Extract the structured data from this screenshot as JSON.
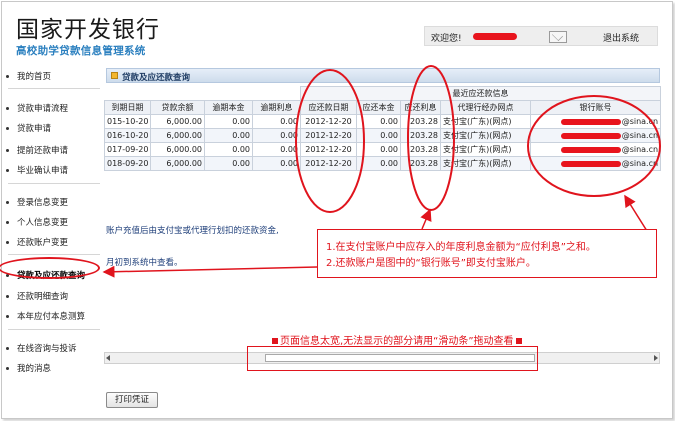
{
  "header": {
    "logo_main": "国家开发银行",
    "logo_sub": "高校助学贷款信息管理系统",
    "welcome": "欢迎您!",
    "logout": "退出系统"
  },
  "sidebar": {
    "items": [
      {
        "label": "我的首页"
      },
      {
        "label": "贷款申请流程"
      },
      {
        "label": "贷款申请"
      },
      {
        "label": "提前还款申请"
      },
      {
        "label": "毕业确认申请"
      },
      {
        "label": "登录信息变更"
      },
      {
        "label": "个人信息变更"
      },
      {
        "label": "还款账户变更"
      },
      {
        "label": "贷款及应还款查询",
        "active": true
      },
      {
        "label": "还款明细查询"
      },
      {
        "label": "本年应付本息测算"
      },
      {
        "label": "在线咨询与投诉"
      },
      {
        "label": "我的消息"
      }
    ]
  },
  "panel": {
    "title": "贷款及应还款查询",
    "group_header": "最近应还款信息",
    "columns": [
      "到期日期",
      "贷款余额",
      "逾期本金",
      "逾期利息",
      "应还款日期",
      "应还本金",
      "应还利息",
      "代理行经办网点",
      "银行账号"
    ],
    "rows": [
      [
        "015-10-20",
        "6,000.00",
        "0.00",
        "0.00",
        "2012-12-20",
        "0.00",
        "203.28",
        "支付宝(广东)(网点)",
        "@sina.cn"
      ],
      [
        "016-10-20",
        "6,000.00",
        "0.00",
        "0.00",
        "2012-12-20",
        "0.00",
        "203.28",
        "支付宝(广东)(网点)",
        "@sina.cn"
      ],
      [
        "017-09-20",
        "6,000.00",
        "0.00",
        "0.00",
        "2012-12-20",
        "0.00",
        "203.28",
        "支付宝(广东)(网点)",
        "@sina.cn"
      ],
      [
        "018-09-20",
        "6,000.00",
        "0.00",
        "0.00",
        "2012-12-20",
        "0.00",
        "203.28",
        "支付宝(广东)(网点)",
        "@sina.cn"
      ]
    ],
    "note1": "账户充值后由支付宝或代理行划扣的还款资金,",
    "note2": "月初到系统中查看。"
  },
  "annotations": {
    "callout_line1": "1.在支付宝账户中应存入的年度利息金额为“应付利息”之和。",
    "callout_line2": "2.还款账户是图中的“银行账号”即支付宝账户。",
    "scroll_note": "页面信息太宽,无法显示的部分请用“滑动条”拖动查看",
    "color": "#e0141d"
  },
  "footer": {
    "print_button": "打印凭证"
  }
}
